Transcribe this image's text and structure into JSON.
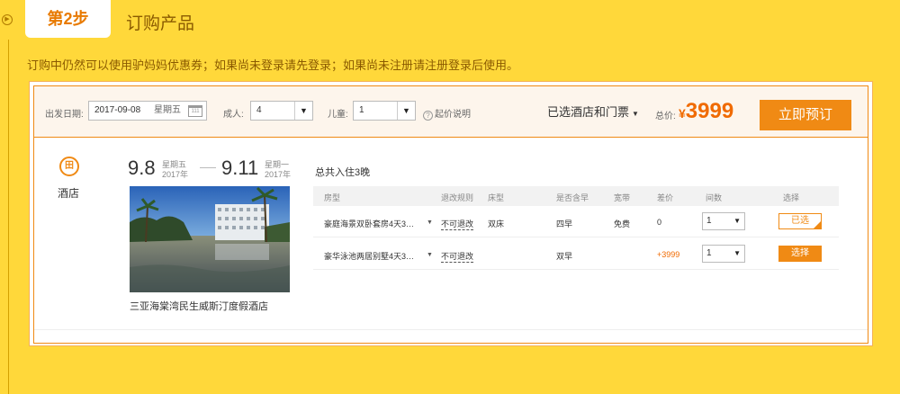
{
  "step": {
    "tab": "第2步",
    "title": "订购产品",
    "circle_icon": "circle-arrow-icon"
  },
  "notice": "订购中仍然可以使用驴妈妈优惠券；如果尚未登录请先登录；如果尚未注册请注册登录后使用。",
  "booking": {
    "date_label": "出发日期:",
    "date_value": "2017-09-08",
    "weekday": "星期五",
    "adult_label": "成人:",
    "adult_value": "4",
    "child_label": "儿童:",
    "child_value": "1",
    "price_note": "起价说明",
    "selected_label": "已选酒店和门票",
    "total_label": "总价:",
    "currency": "¥",
    "total": "3999",
    "book_button": "立即预订"
  },
  "hotel": {
    "icon_char": "田",
    "label": "酒店",
    "checkin": {
      "date": "9.8",
      "weekday": "星期五",
      "year": "2017年"
    },
    "checkout": {
      "date": "9.11",
      "weekday": "星期一",
      "year": "2017年"
    },
    "nights": "总共入住3晚",
    "name": "三亚海棠湾民生威斯汀度假酒店"
  },
  "table": {
    "headers": [
      "房型",
      "退改规则",
      "床型",
      "是否含早",
      "宽带",
      "差价",
      "间数",
      "选择"
    ],
    "rows": [
      {
        "room": "豪庭海景双卧套房4天3…",
        "rule": "不可退改",
        "bed": "双床",
        "breakfast": "四早",
        "broadband": "免费",
        "diff": "0",
        "count": "1",
        "select": "已选",
        "selected": true
      },
      {
        "room": "豪华泳池两居别墅4天3…",
        "rule": "不可退改",
        "bed": "",
        "breakfast": "双早",
        "broadband": "",
        "diff": "+3999",
        "count": "1",
        "select": "选择",
        "selected": false
      }
    ]
  },
  "colors": {
    "accent": "#f08a14",
    "background": "#ffd83a",
    "price": "#f06a00"
  }
}
